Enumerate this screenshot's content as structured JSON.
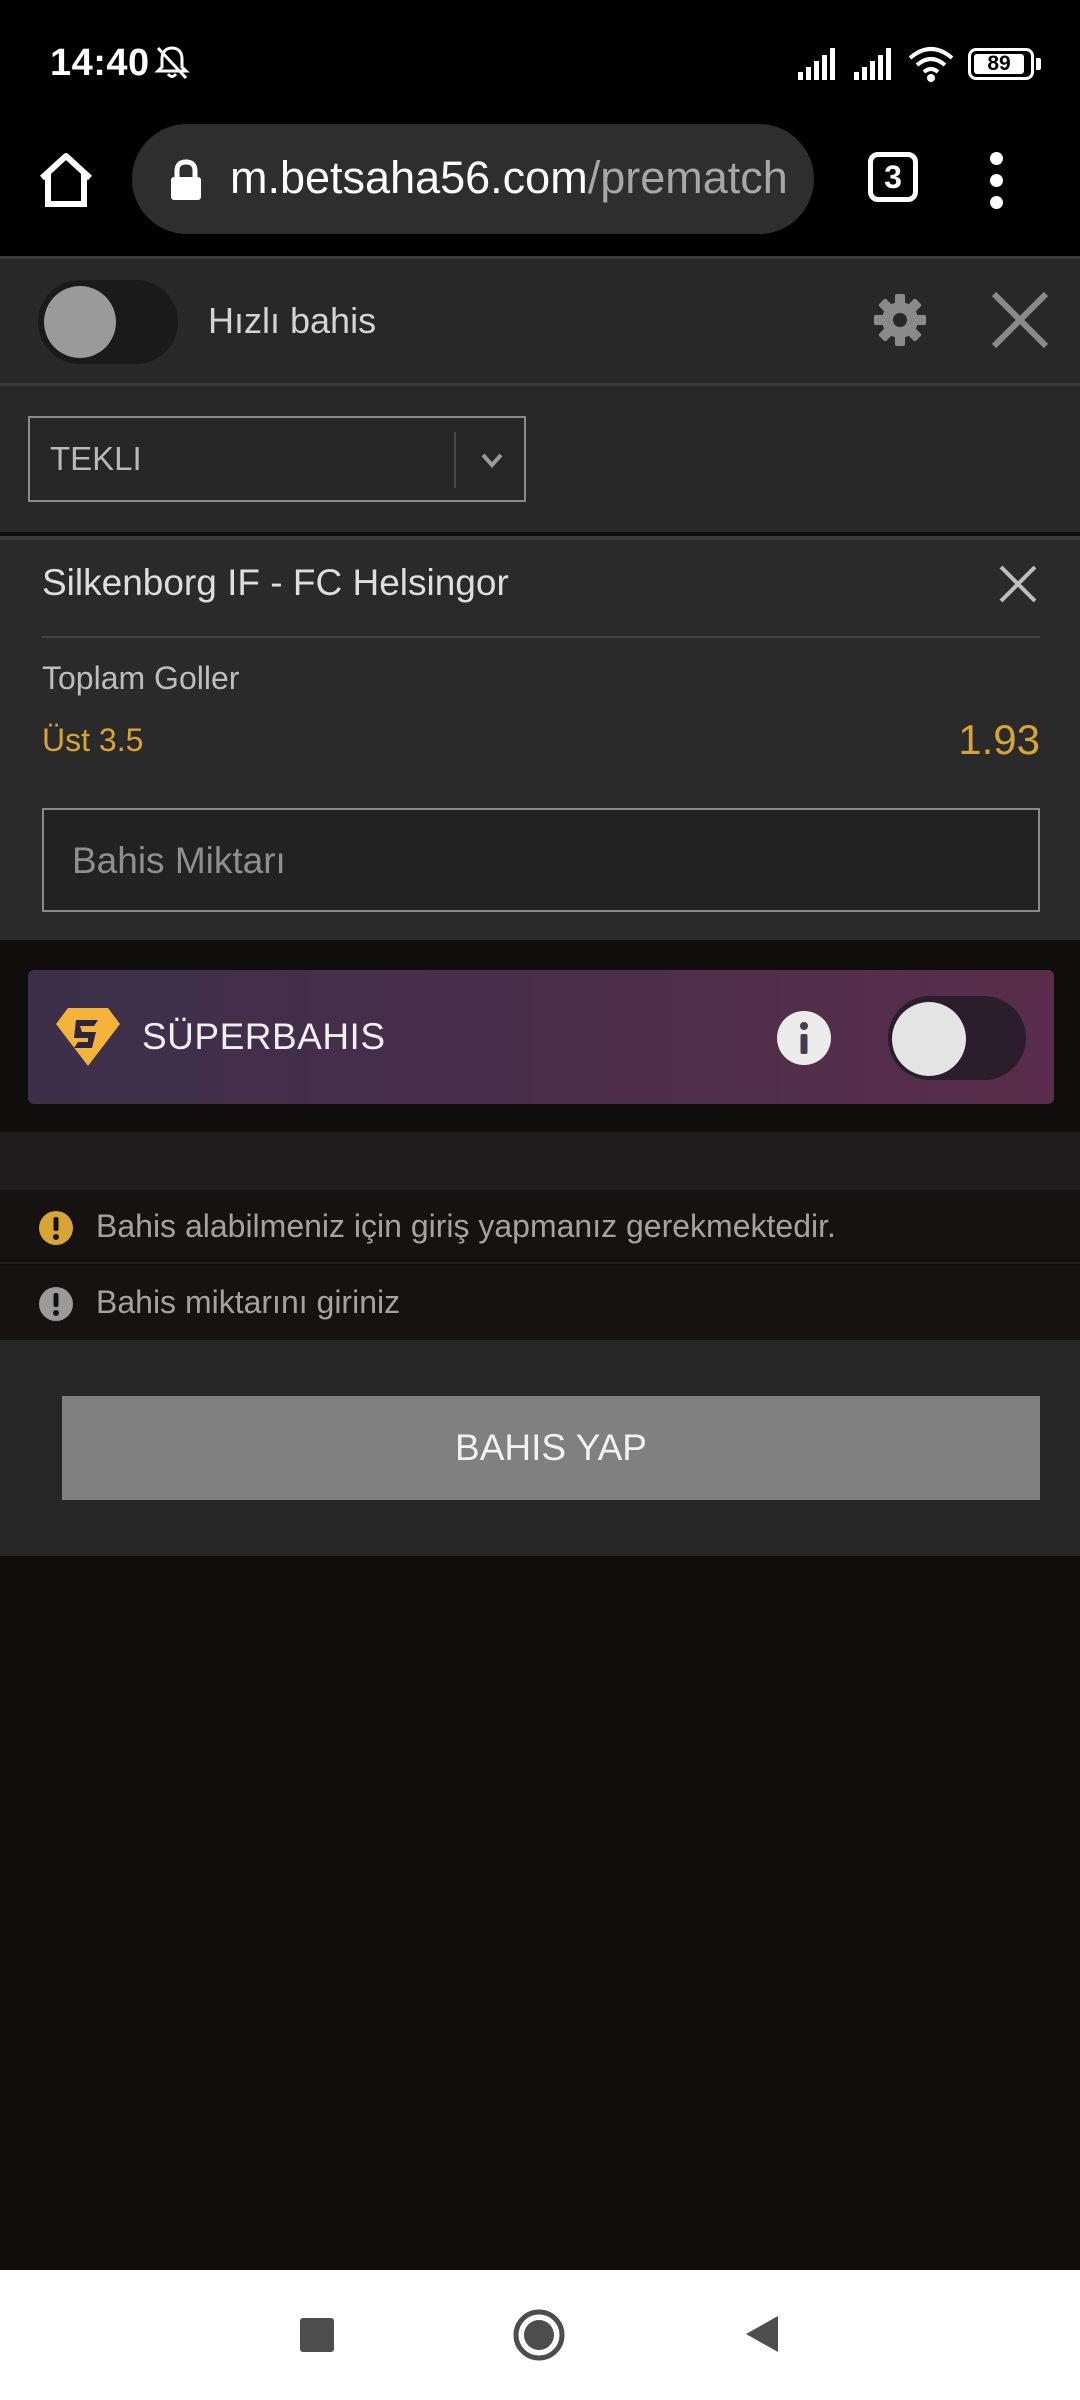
{
  "status_bar": {
    "time": "14:40",
    "battery": "89",
    "icons": [
      "bell-off-icon",
      "signal-icon",
      "signal-icon",
      "wifi-icon",
      "battery-icon"
    ]
  },
  "browser": {
    "url_host": "m.betsaha56.com",
    "url_path": "/prematch",
    "tab_count": "3",
    "icons": [
      "home-icon",
      "lock-icon",
      "tabs-icon",
      "more-vert-icon"
    ]
  },
  "quick_bet": {
    "label": "Hızlı bahis",
    "enabled": false,
    "icons": [
      "gear-icon",
      "close-icon"
    ]
  },
  "bet_type": {
    "value": "TEKLI",
    "icon": "chevron-down-icon"
  },
  "bet": {
    "match": "Silkenborg IF - FC Helsingor",
    "market": "Toplam Goller",
    "selection": "Üst 3.5",
    "odds": "1.93",
    "stake_placeholder": "Bahis Miktarı"
  },
  "superbahis": {
    "label": "SÜPERBAHIS",
    "enabled": false,
    "icons": [
      "superbahis-logo-icon",
      "info-icon"
    ]
  },
  "messages": [
    {
      "text": "Bahis alabilmeniz için giriş yapmanız gerekmektedir.",
      "color": "#d8a433"
    },
    {
      "text": "Bahis miktarını giriniz",
      "color": "#9a9a9a"
    }
  ],
  "actions": {
    "place_bet": "BAHIS YAP"
  },
  "colors": {
    "accent": "#d8a433",
    "background": "#100d0d",
    "panel": "#2a2a2a",
    "button": "#808080"
  }
}
